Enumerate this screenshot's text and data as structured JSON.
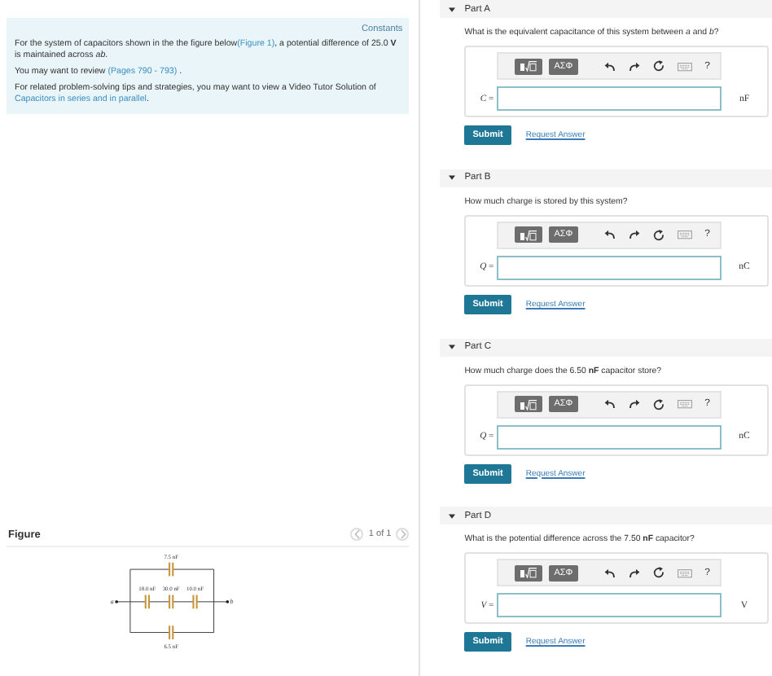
{
  "info": {
    "constants": "Constants",
    "paragraphs": [
      {
        "before": "For the system of capacitors shown in the the figure below",
        "link": "(Figure 1)",
        "after": ", a potential difference of 25.0 **V** is maintained across *ab*."
      },
      {
        "before": "You may want to review ",
        "link": "(Pages 790 - 793)",
        "after": " ."
      },
      {
        "before": "For related problem-solving tips and strategies, you may want to view a Video Tutor Solution of ",
        "link": "Capacitors in series and in parallel",
        "after": "."
      }
    ]
  },
  "figure": {
    "title": "Figure",
    "pager": "1 of 1",
    "labels": {
      "top": "7.5 nF",
      "middle": [
        "18.0 nF",
        "30.0 nF",
        "10.0 nF"
      ],
      "bottom": "6.5 nF",
      "a": "a",
      "b": "b"
    }
  },
  "parts": [
    {
      "label": "Part A",
      "expanded": true,
      "question": "What is the equivalent capacitance of this system between *a* and *b*?",
      "symbols": "ΑΣΦ",
      "help": "?",
      "variable": "C",
      "equals": "=",
      "unit": "nF",
      "submit": "Submit",
      "request": "Request Answer"
    },
    {
      "label": "Part B",
      "expanded": true,
      "question": "How much charge is stored by this system?",
      "symbols": "ΑΣΦ",
      "help": "?",
      "variable": "Q",
      "equals": "=",
      "unit": "nC",
      "submit": "Submit",
      "request": "Request Answer"
    },
    {
      "label": "Part C",
      "expanded": true,
      "question": "How much charge does the 6.50 **nF** capacitor store?",
      "symbols": "ΑΣΦ",
      "help": "?",
      "variable": "Q",
      "equals": "=",
      "unit": "nC",
      "submit": "Submit",
      "request": "Request Answer"
    },
    {
      "label": "Part D",
      "expanded": true,
      "question": "What is the potential difference across the 7.50 **nF** capacitor?",
      "symbols": "ΑΣΦ",
      "help": "?",
      "variable": "V",
      "equals": "=",
      "unit": "V",
      "submit": "Submit",
      "request": "Request Answer"
    }
  ]
}
